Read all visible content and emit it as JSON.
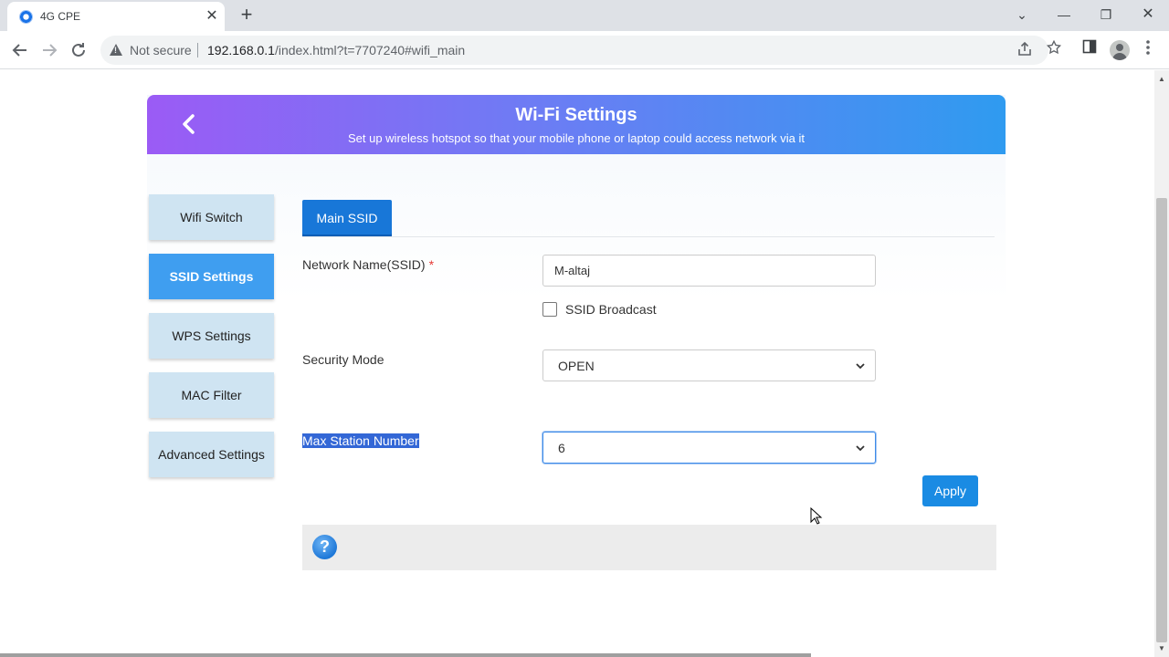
{
  "browser": {
    "tab_title": "4G CPE",
    "tab_close": "✕",
    "new_tab": "+",
    "security_label": "Not secure",
    "url_host": "192.168.0.1",
    "url_path": "/index.html?t=7707240#wifi_main",
    "window_controls": {
      "minimize": "—",
      "restore": "❐",
      "close": "✕"
    },
    "tab_search": "⌄"
  },
  "header": {
    "title": "Wi-Fi Settings",
    "subtitle": "Set up wireless hotspot so that your mobile phone or laptop could access network via it"
  },
  "sidebar": {
    "items": [
      {
        "label": "Wifi Switch",
        "active": false
      },
      {
        "label": "SSID Settings",
        "active": true
      },
      {
        "label": "WPS Settings",
        "active": false
      },
      {
        "label": "MAC Filter",
        "active": false
      },
      {
        "label": "Advanced Settings",
        "active": false
      }
    ]
  },
  "tabs": {
    "main_ssid": "Main SSID"
  },
  "form": {
    "ssid_label": "Network Name(SSID)",
    "required_mark": "*",
    "ssid_value": "M-altaj",
    "broadcast_label": "SSID Broadcast",
    "broadcast_checked": false,
    "security_label": "Security Mode",
    "security_value": "OPEN",
    "max_station_label": "Max Station Number",
    "max_station_value": "6",
    "apply_label": "Apply"
  },
  "help": {
    "icon_text": "?"
  },
  "colors": {
    "banner_start": "#9b5bf5",
    "banner_end": "#2f9bf0",
    "active_sidebar": "#3f9ef0",
    "sidebar": "#cfe4f2",
    "primary_button": "#1a8be3"
  }
}
